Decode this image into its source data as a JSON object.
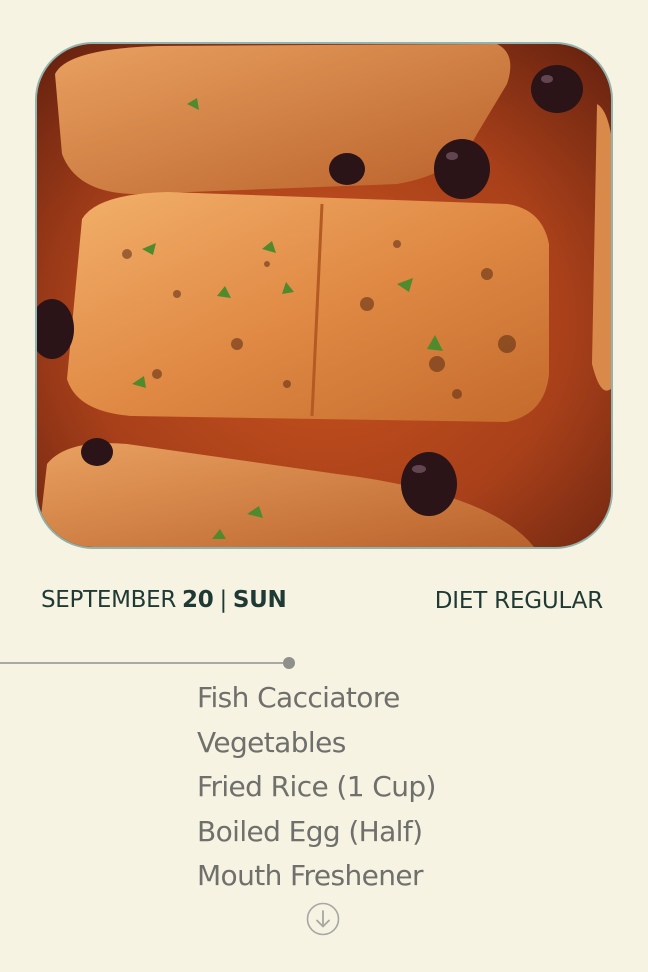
{
  "header": {
    "month": "SEPTEMBER",
    "day": "20",
    "separator": "|",
    "weekday": "SUN",
    "diet_label": "DIET REGULAR"
  },
  "hero_image": {
    "subject": "pan-seared salmon fillets in tomato olive sauce",
    "icon": "food-photo"
  },
  "menu": {
    "items": [
      "Fish Cacciatore",
      "Vegetables",
      "Fried Rice (1 Cup)",
      "Boiled Egg (Half)",
      "Mouth Freshener"
    ]
  },
  "controls": {
    "scroll_down_icon": "arrow-down-circle-icon"
  },
  "colors": {
    "background": "#f6f3e2",
    "header_text": "#1f3a34",
    "menu_text": "#6f6f6c",
    "image_border": "#8fb3ae",
    "timeline": "#a9a9a4"
  }
}
